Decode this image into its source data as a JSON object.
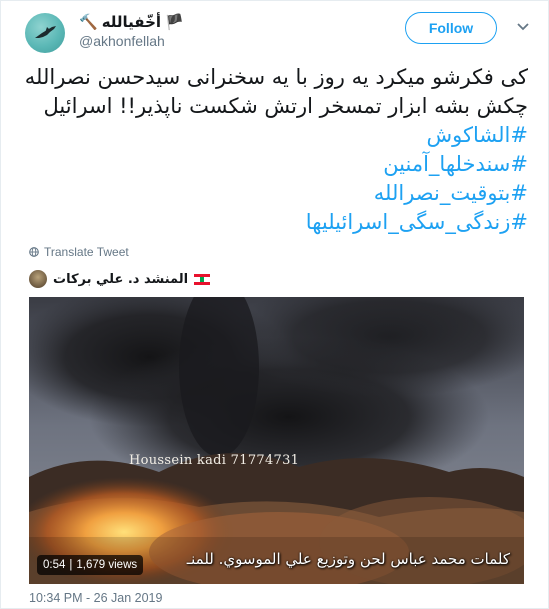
{
  "account": {
    "display_name_icons": [
      "hammer-icon",
      "black-flag-icon"
    ],
    "display_name": "أخّفيالله",
    "handle": "@akhonfellah"
  },
  "header": {
    "follow_label": "Follow"
  },
  "tweet": {
    "lines": [
      "کی فکرشو میکرد یه روز با یه سخنرانی سیدحسن نصرالله",
      "چکش بشه ابزار تمسخر ارتش شکست ناپذیر!! اسرائیل"
    ],
    "hashtags": [
      "#الشاکوش",
      "#سندخلها_آمنين",
      "#بتوقیت_نصرالله",
      "#زندگی_سگی_اسرائیلیها"
    ],
    "translate_label": "Translate Tweet",
    "timestamp": "10:34 PM - 26 Jan 2019"
  },
  "attribution": {
    "name": "المنشد د. علي بركات",
    "flag": "lebanon-flag-icon"
  },
  "video": {
    "watermark": "Houssein kadi 71774731",
    "subtitle": "كلمات محمد عباس    لحن وتوزيع علي الموسوي.  للمنـ",
    "duration": "0:54",
    "views": "1,679 views"
  },
  "colors": {
    "accent": "#1da1f2",
    "secondary_text": "#657786",
    "text": "#14171a"
  }
}
